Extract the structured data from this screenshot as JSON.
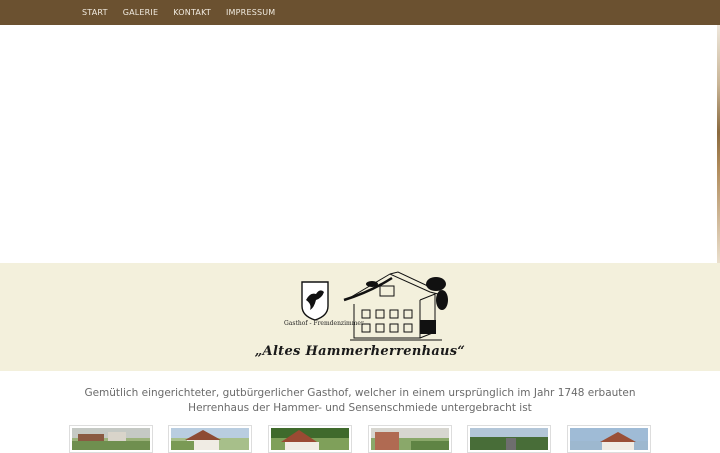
{
  "nav": {
    "items": [
      {
        "label": "START"
      },
      {
        "label": "GALERIE"
      },
      {
        "label": "KONTAKT"
      },
      {
        "label": "IMPRESSUM"
      }
    ]
  },
  "banner": {
    "logo_subtitle": "Gasthof - Fremdenzimmer",
    "logo_title": "„Altes Hammerherrenhaus“"
  },
  "intro": {
    "text": "Gemütlich eingerichteter, gutbürgerlicher Gasthof, welcher in einem ursprünglich im Jahr 1748 erbauten Herrenhaus der Hammer- und Sensenschmiede untergebracht ist"
  },
  "gallery": {
    "thumbnails": [
      {
        "name": "gallery-thumb-1"
      },
      {
        "name": "gallery-thumb-2"
      },
      {
        "name": "gallery-thumb-3"
      },
      {
        "name": "gallery-thumb-4"
      },
      {
        "name": "gallery-thumb-5"
      },
      {
        "name": "gallery-thumb-6"
      }
    ]
  },
  "colors": {
    "nav_bg": "#6b5130",
    "nav_text": "#f1ebe0",
    "banner_bg": "#f3f0dc",
    "intro_text": "#6a6a6a"
  }
}
